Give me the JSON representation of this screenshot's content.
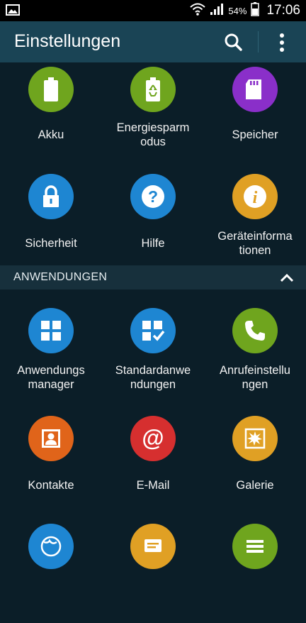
{
  "status_bar": {
    "battery_percent": "54%",
    "time": "17:06",
    "icons": [
      "image-notification-icon",
      "wifi-icon",
      "signal-icon",
      "battery-icon"
    ]
  },
  "action_bar": {
    "title": "Einstellungen",
    "search_icon": "search-icon",
    "more_icon": "more-vert-icon"
  },
  "top_items": [
    {
      "label": "Akku",
      "icon": "battery-icon",
      "color": "#6fa51e"
    },
    {
      "label": "Energiesparm\nodus",
      "icon": "power-saving-icon",
      "color": "#6fa51e"
    },
    {
      "label": "Speicher",
      "icon": "sd-card-icon",
      "color": "#8a2fc9"
    },
    {
      "label": "Sicherheit",
      "icon": "lock-icon",
      "color": "#1e86d2"
    },
    {
      "label": "Hilfe",
      "icon": "help-icon",
      "color": "#1e86d2"
    },
    {
      "label": "Geräteinforma\ntionen",
      "icon": "info-icon",
      "color": "#e0a024"
    }
  ],
  "section": {
    "title": "ANWENDUNGEN",
    "icon": "chevron-up-icon"
  },
  "app_items": [
    {
      "label": "Anwendungs\nmanager",
      "icon": "app-grid-icon",
      "color": "#1e86d2"
    },
    {
      "label": "Standardanwe\nndungen",
      "icon": "default-apps-icon",
      "color": "#1e86d2"
    },
    {
      "label": "Anrufeinstellu\nngen",
      "icon": "phone-icon",
      "color": "#6fa51e"
    },
    {
      "label": "Kontakte",
      "icon": "contact-icon",
      "color": "#e0641a"
    },
    {
      "label": "E-Mail",
      "icon": "email-icon",
      "color": "#d62f2f"
    },
    {
      "label": "Galerie",
      "icon": "gallery-icon",
      "color": "#e0a024"
    }
  ],
  "bottom_partial_items": [
    {
      "icon": "globe-icon",
      "color": "#1e86d2"
    },
    {
      "icon": "message-icon",
      "color": "#e0a024"
    },
    {
      "icon": "list-icon",
      "color": "#6fa51e"
    }
  ]
}
